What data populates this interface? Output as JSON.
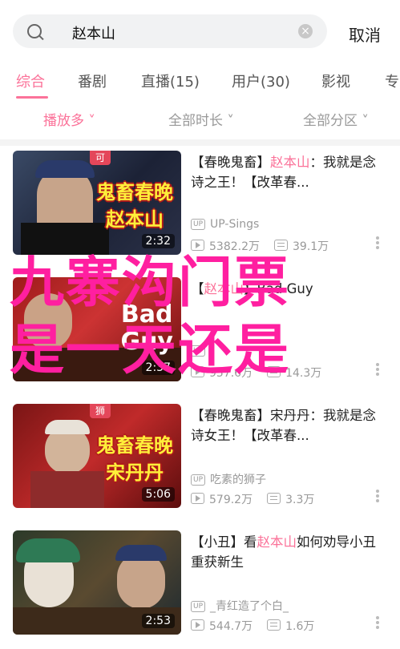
{
  "search": {
    "query": "赵本山",
    "cancel_label": "取消"
  },
  "tabs": [
    {
      "label": "综合"
    },
    {
      "label": "番剧"
    },
    {
      "label": "直播(15)"
    },
    {
      "label": "用户(30)"
    },
    {
      "label": "影视"
    },
    {
      "label": "专"
    }
  ],
  "filters": [
    {
      "label": "播放多 ˅"
    },
    {
      "label": "全部时长 ˅"
    },
    {
      "label": "全部分区 ˅"
    }
  ],
  "videos": [
    {
      "title_pre": "【春晚鬼畜】",
      "title_hl": "赵本山",
      "title_post": "：我就是念诗之王！【改革春...",
      "uploader": "UP-Sings",
      "plays": "5382.2万",
      "danmaku": "39.1万",
      "duration": "2:32",
      "overlay_line1": "鬼畜春晚",
      "overlay_line2": "赵本山",
      "badge": "可"
    },
    {
      "title_pre": "【",
      "title_hl": "赵本山",
      "title_post": "】Bad Guy",
      "uploader": "",
      "plays": "957.6万",
      "danmaku": "14.3万",
      "duration": "2:37",
      "overlay_line1": "Bad",
      "overlay_line2": "Guy",
      "badge": ""
    },
    {
      "title_pre": "【春晚鬼畜】宋丹丹：我就是念诗女王！【改革春...",
      "title_hl": "",
      "title_post": "",
      "uploader": "吃素的狮子",
      "plays": "579.2万",
      "danmaku": "3.3万",
      "duration": "5:06",
      "overlay_line1": "鬼畜春晚",
      "overlay_line2": "宋丹丹",
      "badge": "狮"
    },
    {
      "title_pre": "【小丑】看",
      "title_hl": "赵本山",
      "title_post": "如何劝导小丑重获新生",
      "uploader": "_青红造了个白_",
      "plays": "544.7万",
      "danmaku": "1.6万",
      "duration": "2:53",
      "overlay_line1": "",
      "overlay_line2": "",
      "badge": ""
    }
  ],
  "watermark": {
    "line1": "九寨沟门票",
    "line2": "是一天还是"
  },
  "colors": {
    "accent": "#fb7299",
    "watermark": "#ff1fa0"
  },
  "icons": [
    "search-icon",
    "clear-icon",
    "up-icon",
    "play-icon",
    "danmaku-icon",
    "more-icon"
  ]
}
